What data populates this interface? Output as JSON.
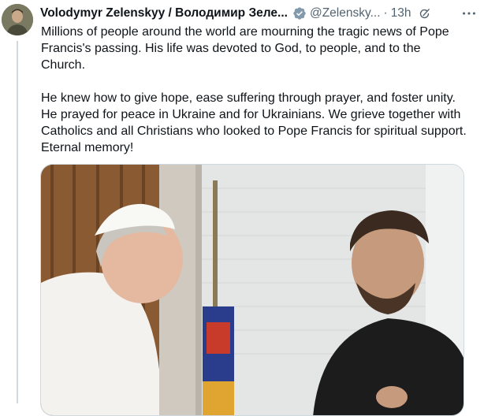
{
  "tweet": {
    "author_name": "Volodymyr Zelenskyy / Володимир Зеле...",
    "author_handle": "@Zelensky...",
    "separator": "·",
    "time": "13h",
    "verified_icon": "verified-badge-icon",
    "edited_icon": "edit-history-icon",
    "more_icon": "more-options-icon",
    "paragraphs": [
      "Millions of people around the world are mourning the tragic news of Pope Francis's passing. His life was devoted to God, to people, and to the Church.",
      "He knew how to give hope, ease suffering through prayer, and foster unity. He prayed for peace in Ukraine and for Ukrainians. We grieve together with Catholics and all Christians who looked to Pope Francis for spiritual support. Eternal memory!"
    ]
  },
  "colors": {
    "text_primary": "#0f1419",
    "text_secondary": "#536471",
    "verified_gray": "#829aab",
    "border": "#cfd9de"
  }
}
